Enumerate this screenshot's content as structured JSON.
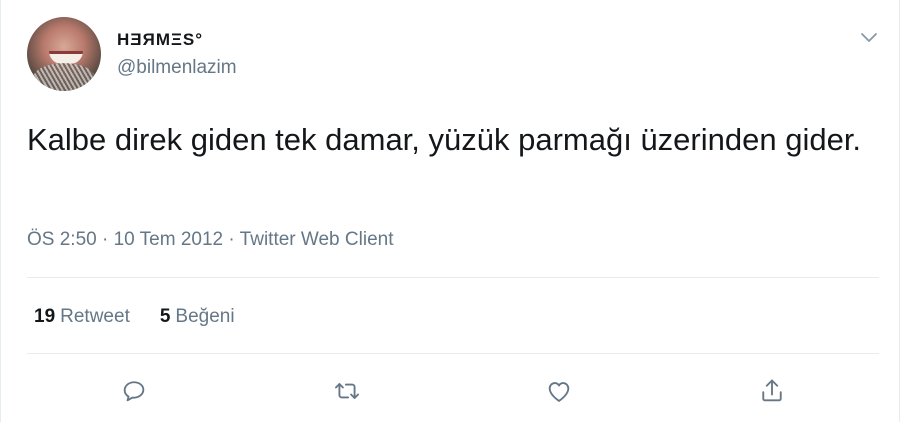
{
  "author": {
    "display_name": "HƎЯMΞS°",
    "username": "@bilmenlazim"
  },
  "tweet": {
    "text": "Kalbe direk giden tek damar, yüzük parmağı üzerinden gider.",
    "time": "ÖS 2:50",
    "date": "10 Tem 2012",
    "source": "Twitter Web Client",
    "separator": "·"
  },
  "stats": {
    "retweet_count": "19",
    "retweet_label": "Retweet",
    "like_count": "5",
    "like_label": "Beğeni"
  },
  "icons": {
    "more": "chevron-down-icon",
    "reply": "reply-icon",
    "retweet": "retweet-icon",
    "like": "heart-icon",
    "share": "share-icon"
  },
  "colors": {
    "text_primary": "#14171a",
    "text_secondary": "#657786",
    "divider": "#e6ecf0"
  }
}
